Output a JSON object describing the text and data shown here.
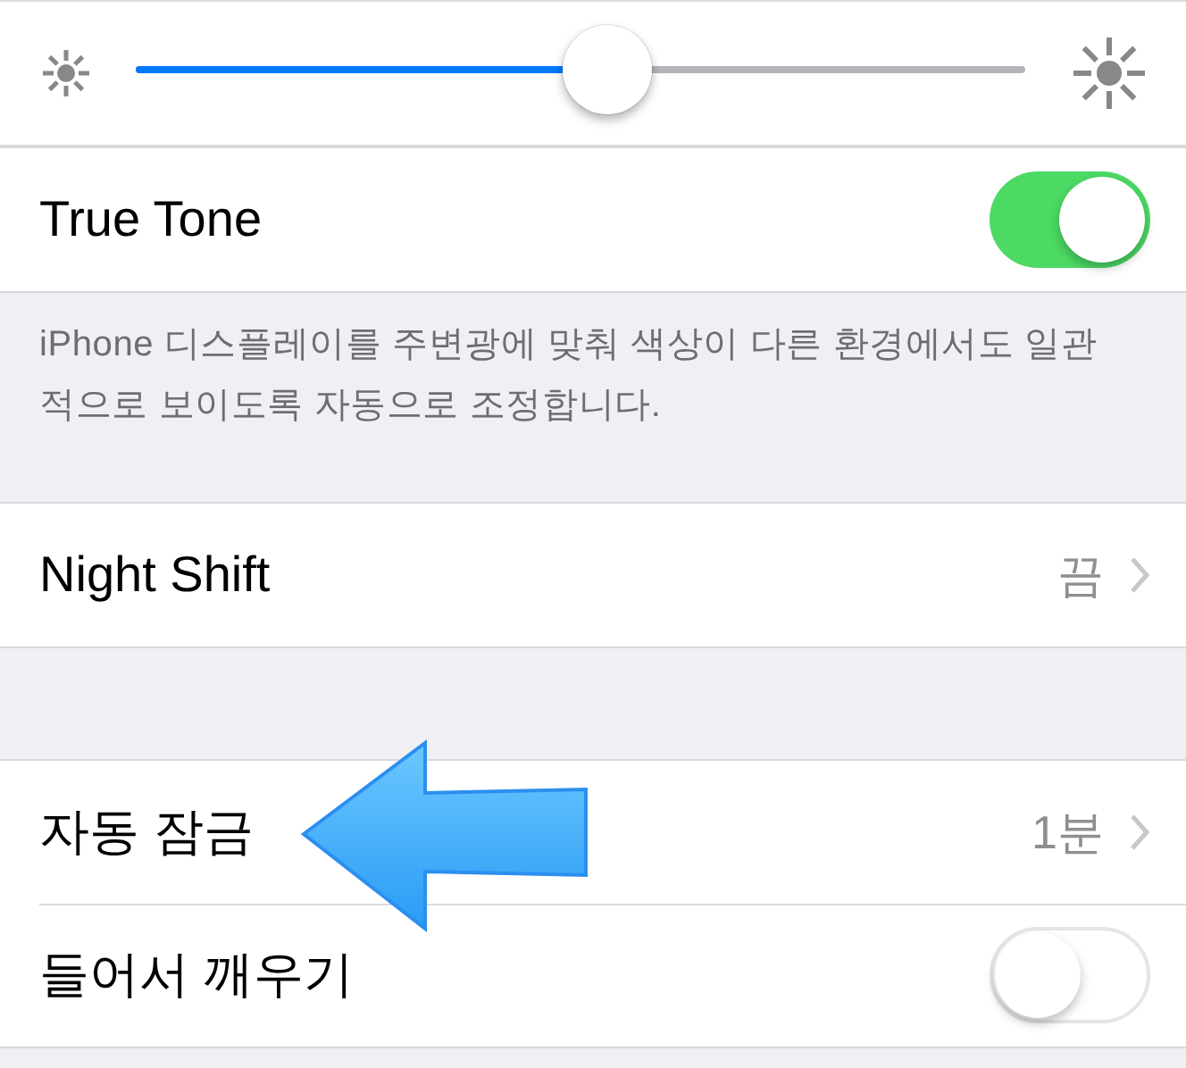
{
  "groups": [
    {
      "rows": [
        {
          "kind": "slider",
          "level": 0.53
        }
      ]
    },
    {
      "rows": [
        {
          "kind": "toggle",
          "label": "True Tone",
          "on": true
        }
      ],
      "footer": "iPhone 디스플레이를 주변광에 맞춰 색상이 다른 환경에서도 일관적으로 보이도록 자동으로 조정합니다."
    },
    {
      "rows": [
        {
          "kind": "disclosure",
          "label": "Night Shift",
          "value": "끔"
        }
      ]
    },
    {
      "rows": [
        {
          "kind": "disclosure",
          "label": "자동 잠금",
          "value": "1분"
        },
        {
          "kind": "toggle",
          "label": "들어서 깨우기",
          "on": false
        }
      ]
    }
  ]
}
